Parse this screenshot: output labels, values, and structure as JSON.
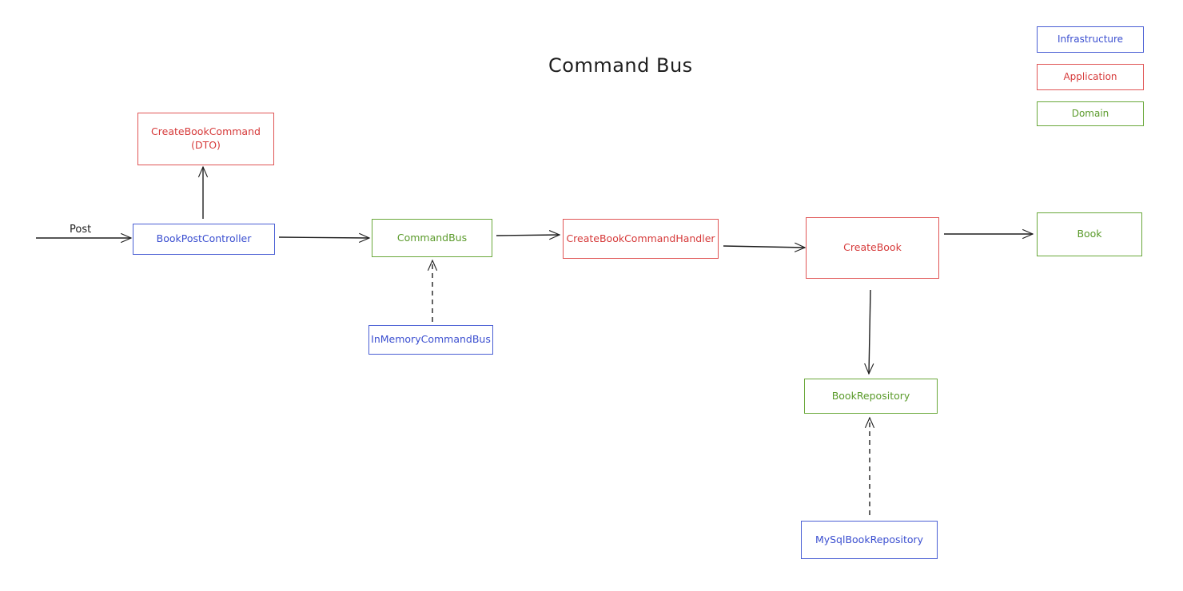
{
  "title": "Command Bus",
  "legend": [
    {
      "label": "Infrastructure",
      "layer": "infrastructure"
    },
    {
      "label": "Application",
      "layer": "application"
    },
    {
      "label": "Domain",
      "layer": "domain"
    }
  ],
  "colors": {
    "infrastructure": "#4a5fd4",
    "application": "#e05555",
    "domain": "#6aa83a",
    "arrow": "#1e1e1e"
  },
  "nodes": {
    "create_book_command": {
      "label": "CreateBookCommand\n(DTO)",
      "layer": "application"
    },
    "book_post_controller": {
      "label": "BookPostController",
      "layer": "infrastructure"
    },
    "command_bus": {
      "label": "CommandBus",
      "layer": "domain"
    },
    "in_memory_command_bus": {
      "label": "InMemoryCommandBus",
      "layer": "infrastructure"
    },
    "create_book_command_handler": {
      "label": "CreateBookCommandHandler",
      "layer": "application"
    },
    "create_book": {
      "label": "CreateBook",
      "layer": "application"
    },
    "book": {
      "label": "Book",
      "layer": "domain"
    },
    "book_repository": {
      "label": "BookRepository",
      "layer": "domain"
    },
    "mysql_book_repository": {
      "label": "MySqlBookRepository",
      "layer": "infrastructure"
    }
  },
  "edges": [
    {
      "from": "external",
      "to": "book_post_controller",
      "label": "Post",
      "style": "solid"
    },
    {
      "from": "book_post_controller",
      "to": "create_book_command",
      "label": "",
      "style": "solid"
    },
    {
      "from": "book_post_controller",
      "to": "command_bus",
      "label": "",
      "style": "solid"
    },
    {
      "from": "in_memory_command_bus",
      "to": "command_bus",
      "label": "",
      "style": "dashed"
    },
    {
      "from": "command_bus",
      "to": "create_book_command_handler",
      "label": "",
      "style": "solid"
    },
    {
      "from": "create_book_command_handler",
      "to": "create_book",
      "label": "",
      "style": "solid"
    },
    {
      "from": "create_book",
      "to": "book",
      "label": "",
      "style": "solid"
    },
    {
      "from": "create_book",
      "to": "book_repository",
      "label": "",
      "style": "solid"
    },
    {
      "from": "mysql_book_repository",
      "to": "book_repository",
      "label": "",
      "style": "dashed"
    }
  ]
}
